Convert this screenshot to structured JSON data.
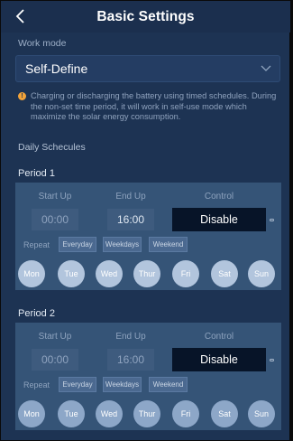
{
  "header": {
    "title": "Basic Settings",
    "back_icon": "chevron-left-icon"
  },
  "work_mode": {
    "label": "Work mode",
    "value": "Self-Define",
    "dropdown_icon": "chevron-down-icon"
  },
  "note": {
    "icon": "warning-icon",
    "text": "Charging or discharging the battery using timed schedules. During the non-set time period, it will work in self-use mode which maximize the solar energy consumption."
  },
  "daily": {
    "label": "Daily Schecules"
  },
  "periods": [
    {
      "title": "Period 1",
      "start_label": "Start Up",
      "end_label": "End Up",
      "control_label": "Control",
      "start_value": "00:00",
      "end_value": "16:00",
      "control_value": "Disable",
      "repeat_label": "Repeat",
      "repeat_options": [
        "Everyday",
        "Weekdays",
        "Weekend"
      ],
      "days": [
        "Mon",
        "Tue",
        "Wed",
        "Thur",
        "Fri",
        "Sat",
        "Sun"
      ]
    },
    {
      "title": "Period 2",
      "start_label": "Start Up",
      "end_label": "End Up",
      "control_label": "Control",
      "start_value": "00:00",
      "end_value": "16:00",
      "control_value": "Disable",
      "repeat_label": "Repeat",
      "repeat_options": [
        "Everyday",
        "Weekdays",
        "Weekend"
      ],
      "days": [
        "Mon",
        "Tue",
        "Wed",
        "Thur",
        "Fri",
        "Sat",
        "Sun"
      ]
    }
  ],
  "colors": {
    "background": "#1d3353",
    "panel": "#355477",
    "control_box": "#071428",
    "day_circle": "#b2c5dd",
    "warning": "#f2a33a"
  }
}
